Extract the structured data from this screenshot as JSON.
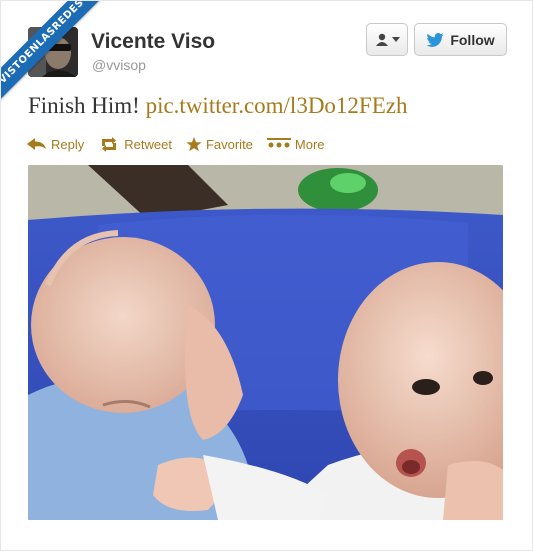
{
  "watermark": {
    "text": "VISTOENLASREDES"
  },
  "profile": {
    "name": "Vicente Viso",
    "handle": "@vvisop"
  },
  "buttons": {
    "user_menu_icon": "user-icon",
    "follow_label": "Follow",
    "follow_icon": "twitter-bird-icon"
  },
  "tweet": {
    "text": "Finish Him!",
    "link": "pic.twitter.com/l3Do12FEzh"
  },
  "actions": [
    {
      "label": "Reply",
      "icon": "reply-icon"
    },
    {
      "label": "Retweet",
      "icon": "retweet-icon"
    },
    {
      "label": "Favorite",
      "icon": "star-icon"
    },
    {
      "label": "More",
      "icon": "more-icon"
    }
  ],
  "colors": {
    "accent": "#a77a1c",
    "follow_bird": "#2b95d8",
    "ribbon": "#1c6bb5"
  }
}
